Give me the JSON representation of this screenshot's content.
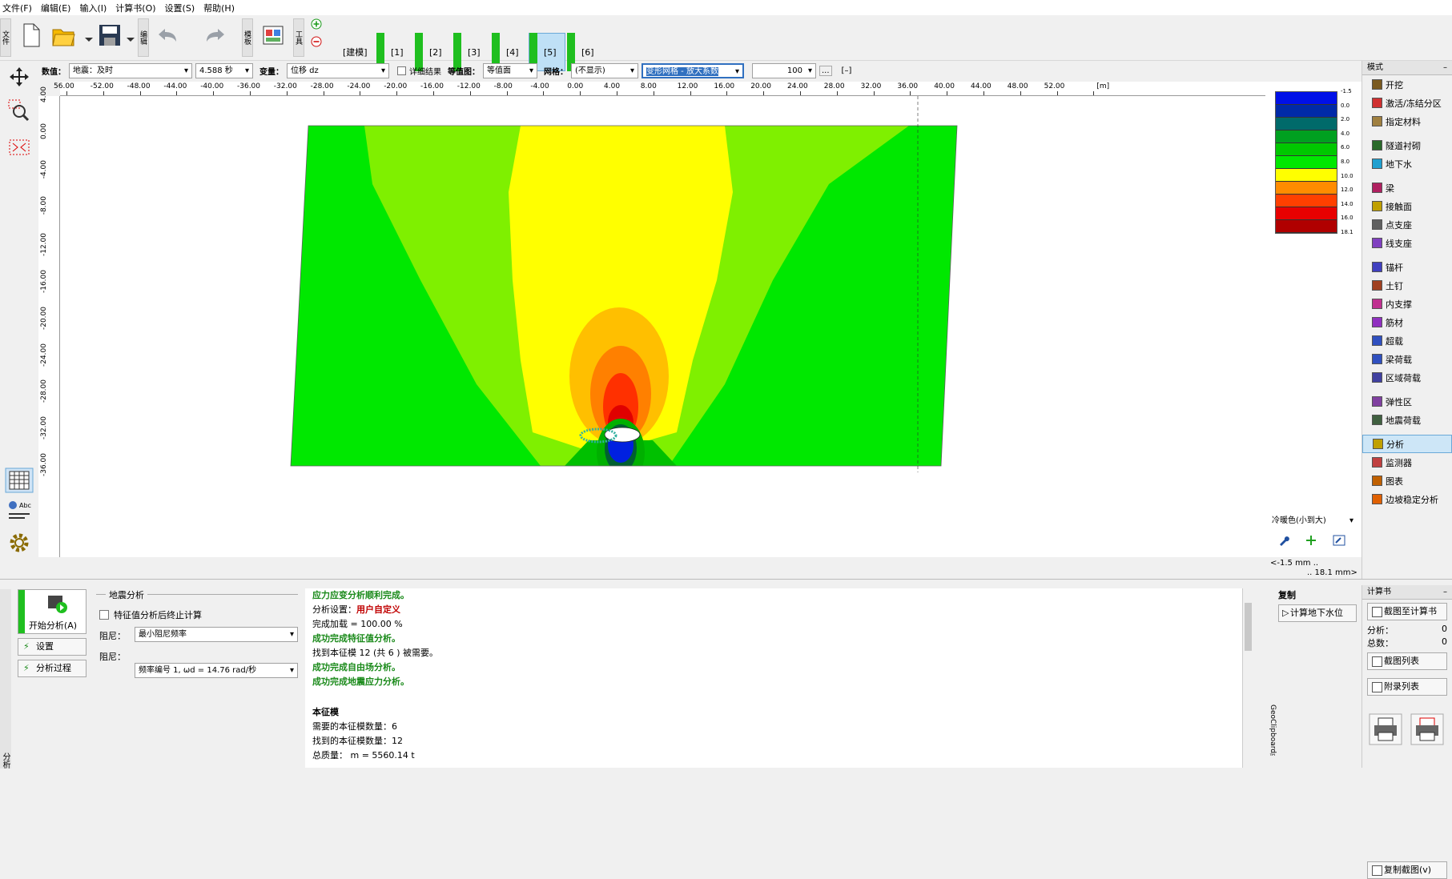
{
  "menu": [
    "文件(F)",
    "编辑(E)",
    "输入(I)",
    "计算书(O)",
    "设置(S)",
    "帮助(H)"
  ],
  "toolbar": {
    "side_file": "文件",
    "side_edit": "编辑",
    "side_template": "模板",
    "side_tool": "工具",
    "stages": [
      "[建模]",
      "[1]",
      "[2]",
      "[3]",
      "[4]",
      "[5]",
      "[6]"
    ],
    "active_stage": 5
  },
  "options": {
    "value_label": "数值：",
    "value_sel": "地震：及时",
    "time_sel": "4.588 秒",
    "var_label": "变量：",
    "var_sel": "位移 dz",
    "detail_label": "详细结果",
    "contour_label": "等值图：",
    "contour_sel": "等值面",
    "mesh_label": "网格：",
    "mesh_sel": "(不显示)",
    "deform_sel": "变形网格 - 放大系数",
    "scale_value": "100",
    "more_btn": "...",
    "collapse_btn": "[–]"
  },
  "ruler_x": [
    "56.00",
    "-52.00",
    "-48.00",
    "-44.00",
    "-40.00",
    "-36.00",
    "-32.00",
    "-28.00",
    "-24.00",
    "-20.00",
    "-16.00",
    "-12.00",
    "-8.00",
    "-4.00",
    "0.00",
    "4.00",
    "8.00",
    "12.00",
    "16.00",
    "20.00",
    "24.00",
    "28.00",
    "32.00",
    "36.00",
    "40.00",
    "44.00",
    "48.00",
    "52.00",
    "[m]"
  ],
  "ruler_y": [
    "4.00",
    "0.00",
    "-4.00",
    "-8.00",
    "-12.00",
    "-16.00",
    "-20.00",
    "-24.00",
    "-28.00",
    "-32.00",
    "-36.00"
  ],
  "legend": {
    "values": [
      "-1.5",
      "0.0",
      "2.0",
      "4.0",
      "6.0",
      "8.0",
      "10.0",
      "12.0",
      "14.0",
      "16.0",
      "18.1"
    ],
    "colors": [
      "#0010e8",
      "#002aa8",
      "#006a6a",
      "#00a020",
      "#00c800",
      "#00e800",
      "#ffff00",
      "#ff8c00",
      "#ff4000",
      "#e80000",
      "#b00000"
    ],
    "scheme": "冷暖色(小到大)",
    "min_text": "<-1.5 mm ..",
    "max_text": ".. 18.1 mm>"
  },
  "right_panel": {
    "title": "模式",
    "items": [
      "开挖",
      "激活/冻结分区",
      "指定材料",
      "隧道衬砌",
      "地下水",
      "梁",
      "接触面",
      "点支座",
      "线支座",
      "锚杆",
      "土钉",
      "内支撑",
      "筋材",
      "超载",
      "梁荷载",
      "区域荷载",
      "弹性区",
      "地震荷载",
      "分析",
      "监测器",
      "图表",
      "边坡稳定分析"
    ],
    "active": "分析"
  },
  "analysis": {
    "start_btn": "开始分析(A)",
    "settings_btn": "设置",
    "process_btn": "分析过程",
    "group_title": "地震分析",
    "checkbox_label": "特征值分析后终止计算",
    "damping1_label": "阻尼：",
    "damping1_sel": "最小阻尼频率",
    "damping2_label": "阻尼：",
    "damping2_sel": "频率编号 1, ωd = 14.76 rad/秒"
  },
  "log": [
    {
      "text": "应力应变分析顺利完成。",
      "cls": "ok"
    },
    {
      "text": "分析设置：",
      "extra": "用户自定义"
    },
    {
      "text": "完成加载 = 100.00 %"
    },
    {
      "text": "成功完成特征值分析。",
      "cls": "ok"
    },
    {
      "text": "找到本征模 12 (共 6 ) 被需要。"
    },
    {
      "text": "成功完成自由场分析。",
      "cls": "ok"
    },
    {
      "text": "成功完成地震应力分析。",
      "cls": "ok"
    },
    {
      "text": ""
    },
    {
      "text": "本征模",
      "cls": "bold"
    },
    {
      "text": "需要的本征模数量：6"
    },
    {
      "text": "找到的本征模数量：12"
    },
    {
      "text": "总质量：              m = 5560.14 t"
    }
  ],
  "copy_panel": {
    "copy_label": "复制",
    "gw_btn": "计算地下水位",
    "vertical_label": "GeoClipboard™"
  },
  "report": {
    "title": "计算书",
    "add_btn": "截图至计算书",
    "analysis_label": "分析：",
    "analysis_val": "0",
    "total_label": "总数：",
    "total_val": "0",
    "list_btn": "截图列表",
    "appendix_btn": "附录列表",
    "copy_btn": "复制截图(v)"
  },
  "bottom_side": "分析"
}
